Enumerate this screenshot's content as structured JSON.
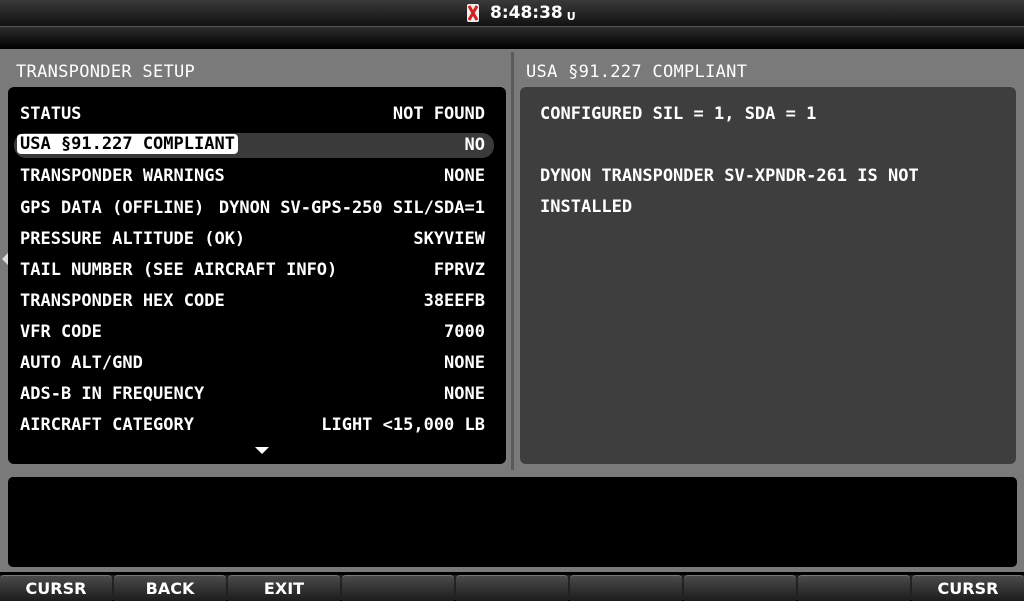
{
  "header": {
    "time": "8:48:38",
    "time_unit": "U"
  },
  "left_panel": {
    "title": "TRANSPONDER SETUP",
    "rows": [
      {
        "label": "STATUS",
        "value": "NOT FOUND"
      },
      {
        "label": "USA §91.227 COMPLIANT",
        "value": "NO",
        "selected": true
      },
      {
        "label": "TRANSPONDER WARNINGS",
        "value": "NONE"
      },
      {
        "label": "GPS DATA (OFFLINE)",
        "value": "DYNON SV-GPS-250 SIL/SDA=1"
      },
      {
        "label": "PRESSURE ALTITUDE (OK)",
        "value": "SKYVIEW"
      },
      {
        "label": "TAIL NUMBER (SEE AIRCRAFT INFO)",
        "value": "FPRVZ"
      },
      {
        "label": "TRANSPONDER HEX CODE",
        "value": "38EEFB"
      },
      {
        "label": "VFR CODE",
        "value": "7000"
      },
      {
        "label": "AUTO ALT/GND",
        "value": "NONE"
      },
      {
        "label": "ADS-B IN FREQUENCY",
        "value": "NONE"
      },
      {
        "label": "AIRCRAFT CATEGORY",
        "value": "LIGHT <15,000 LB"
      }
    ]
  },
  "right_panel": {
    "title": "USA §91.227 COMPLIANT",
    "lines": [
      "CONFIGURED SIL = 1, SDA = 1",
      "DYNON TRANSPONDER SV-XPNDR-261 IS NOT",
      "INSTALLED"
    ]
  },
  "softkeys": [
    "CURSR",
    "BACK",
    "EXIT",
    "",
    "",
    "",
    "",
    "",
    "CURSR"
  ],
  "colors": {
    "frame": "#7a7a7a",
    "right_panel_bg": "#3e3e3e",
    "selected_row_bg": "#3a3a3a",
    "warning_icon": "#d32020"
  }
}
